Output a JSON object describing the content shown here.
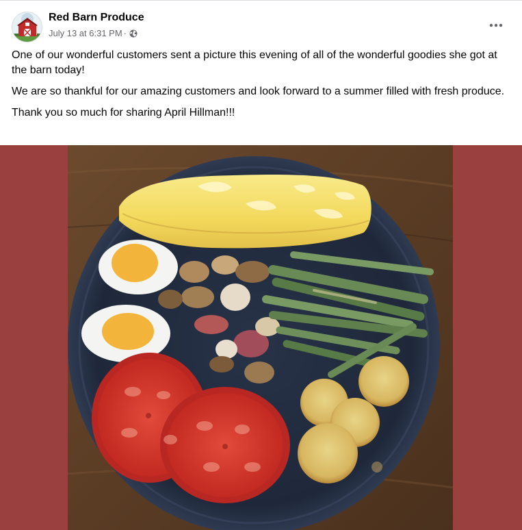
{
  "post": {
    "author": "Red Barn Produce",
    "timestamp": "July 13 at 6:31 PM",
    "separator": "·",
    "audience_icon": "globe-icon",
    "more_icon": "more-horizontal-icon",
    "paragraphs": [
      "One of our wonderful customers sent a picture this evening of all of the wonderful goodies she got at the barn today!",
      "We are so thankful for our amazing customers and look forward to a summer filled with fresh produce.",
      "Thank you so much for sharing April Hillman!!!"
    ]
  },
  "colors": {
    "photo_side_background": "#9a4140",
    "text_primary": "#050505",
    "text_secondary": "#65676b",
    "divider": "#dadde1"
  }
}
